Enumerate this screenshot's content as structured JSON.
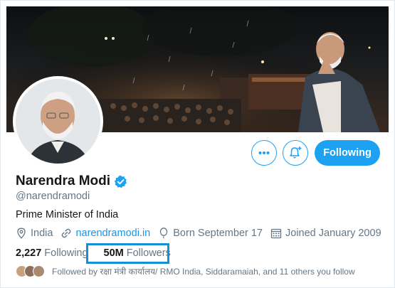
{
  "profile": {
    "name": "Narendra Modi",
    "handle": "@narendramodi",
    "bio": "Prime Minister of India",
    "location": "India",
    "website": "narendramodi.in",
    "born": "Born September 17",
    "joined": "Joined January 2009"
  },
  "stats": {
    "following_count": "2,227",
    "following_label": "Following",
    "followers_count": "50M",
    "followers_label": "Followers"
  },
  "followed_by": "Followed by रक्षा मंत्री कार्यालय/ RMO India, Siddaramaiah, and 11 others you follow",
  "actions": {
    "following_button": "Following",
    "more_icon": "more-icon",
    "notify_icon": "bell-plus-icon"
  },
  "colors": {
    "accent": "#1da1f2",
    "link": "#1b95e0",
    "secondary_text": "#657786",
    "highlight_box": "#1590d6"
  }
}
